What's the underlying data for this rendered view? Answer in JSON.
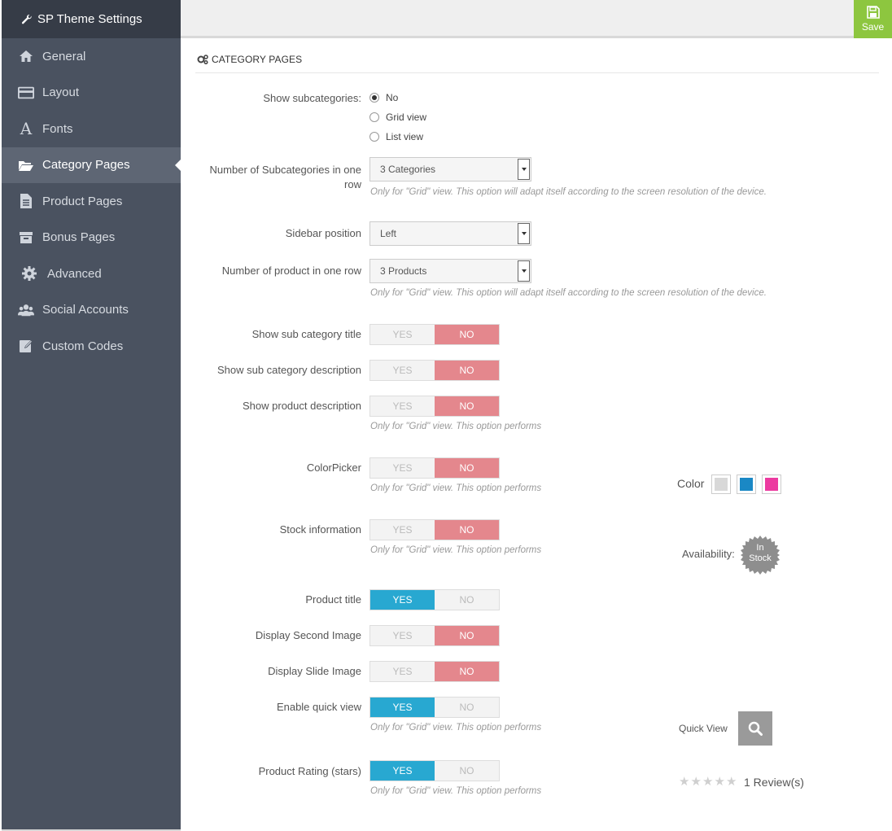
{
  "app_title": "SP Theme Settings",
  "save_label": "Save",
  "sidebar": {
    "items": [
      {
        "label": "General",
        "icon": "home-icon"
      },
      {
        "label": "Layout",
        "icon": "layout-icon"
      },
      {
        "label": "Fonts",
        "icon": "font-icon"
      },
      {
        "label": "Category Pages",
        "icon": "folder-open-icon",
        "active": true
      },
      {
        "label": "Product Pages",
        "icon": "document-icon"
      },
      {
        "label": "Bonus Pages",
        "icon": "archive-icon"
      },
      {
        "label": "Advanced",
        "icon": "gear-icon"
      },
      {
        "label": "Social Accounts",
        "icon": "users-icon"
      },
      {
        "label": "Custom Codes",
        "icon": "edit-icon"
      }
    ]
  },
  "panel": {
    "title": "CATEGORY PAGES",
    "show_subcategories": {
      "label": "Show subcategories:",
      "options": [
        "No",
        "Grid view",
        "List view"
      ],
      "selected": "No"
    },
    "num_subcategories": {
      "label_line1": "Number of Subcategories in one",
      "label_line2": "row",
      "value": "3 Categories",
      "help": "Only for \"Grid\" view. This option will adapt itself according to the screen resolution of the device."
    },
    "sidebar_position": {
      "label": "Sidebar position",
      "value": "Left"
    },
    "num_products": {
      "label": "Number of product in one row",
      "value": "3 Products",
      "help": "Only for \"Grid\" view. This option will adapt itself according to the screen resolution of the device."
    },
    "toggle_labels": {
      "yes": "YES",
      "no": "NO"
    },
    "toggles": {
      "show_sub_category_title": {
        "label": "Show sub category title",
        "value": "NO"
      },
      "show_sub_category_description": {
        "label": "Show sub category description",
        "value": "NO"
      },
      "show_product_description": {
        "label": "Show product description",
        "value": "NO",
        "help": "Only for \"Grid\" view. This option performs"
      },
      "colorpicker": {
        "label": "ColorPicker",
        "value": "NO",
        "help": "Only for \"Grid\" view. This option performs"
      },
      "stock_information": {
        "label": "Stock information",
        "value": "NO",
        "help": "Only for \"Grid\" view. This option performs"
      },
      "product_title": {
        "label": "Product title",
        "value": "YES"
      },
      "display_second_image": {
        "label": "Display Second Image",
        "value": "NO"
      },
      "display_slide_image": {
        "label": "Display Slide Image",
        "value": "NO"
      },
      "enable_quick_view": {
        "label": "Enable quick view",
        "value": "YES",
        "help": "Only for \"Grid\" view. This option performs"
      },
      "product_rating": {
        "label": "Product Rating (stars)",
        "value": "YES",
        "help": "Only for \"Grid\" view. This option performs"
      }
    }
  },
  "previews": {
    "color_label": "Color",
    "swatch_colors": [
      "#d8d8d8",
      "#1a88c5",
      "#ec3aa0"
    ],
    "availability_label": "Availability:",
    "stock_badge_line1": "In",
    "stock_badge_line2": "Stock",
    "quick_view_label": "Quick View",
    "review_text": "1 Review(s)",
    "stars": "★★★★★"
  },
  "colors": {
    "sidebar_bg": "#4a5260",
    "toggle_no_active": "#e4878d",
    "toggle_yes_active": "#28a8d1",
    "save_green": "#8dc63f"
  }
}
